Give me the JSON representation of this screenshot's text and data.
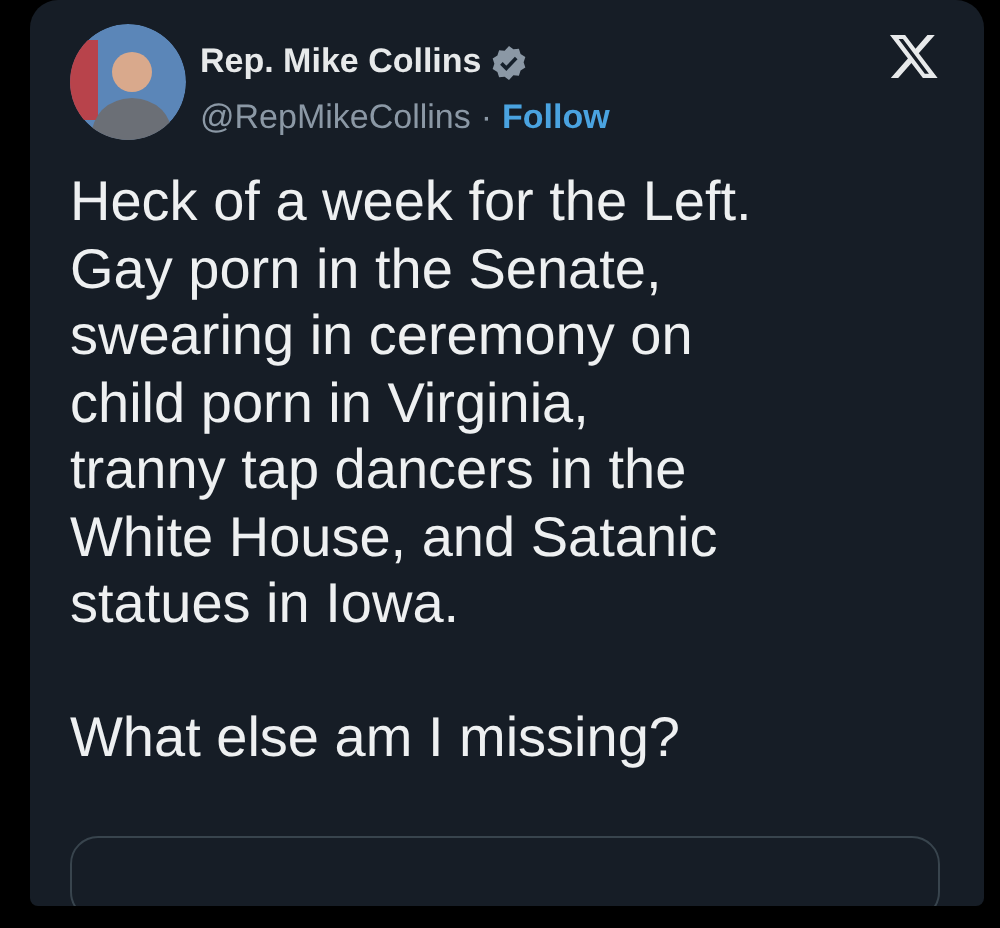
{
  "post": {
    "author": {
      "name": "Rep. Mike Collins",
      "verified": true,
      "handle": "@RepMikeCollins",
      "separator": "·",
      "follow": "Follow"
    },
    "paragraphs": [
      "Heck of a week for the Left.\nGay porn in the Senate,\nswearing in ceremony on\nchild porn in Virginia,\ntranny tap dancers in the\nWhite House, and Satanic\nstatues in Iowa.",
      "What else am I missing?"
    ]
  }
}
